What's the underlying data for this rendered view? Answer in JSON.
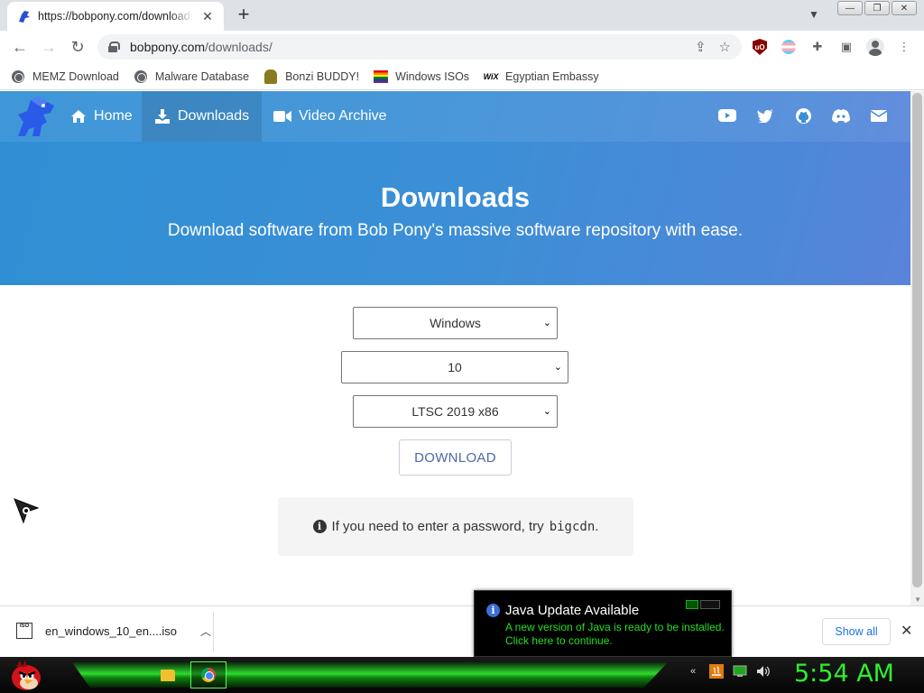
{
  "browser": {
    "tab": {
      "title": "https://bobpony.com/downloads/"
    },
    "url": {
      "host": "bobpony.com",
      "path": "/downloads/"
    },
    "bookmarks": [
      {
        "label": "MEMZ Download",
        "icon": "globe-icon"
      },
      {
        "label": "Malware Database",
        "icon": "globe-icon"
      },
      {
        "label": "Bonzi BUDDY!",
        "icon": "bonzi-icon"
      },
      {
        "label": "Windows ISOs",
        "icon": "rainbow-flag-icon"
      },
      {
        "label": "Egyptian Embassy",
        "icon": "wix-icon",
        "icon_text": "WiX"
      }
    ]
  },
  "site": {
    "nav": [
      {
        "label": "Home",
        "icon": "home-icon",
        "active": false
      },
      {
        "label": "Downloads",
        "icon": "download-icon",
        "active": true
      },
      {
        "label": "Video Archive",
        "icon": "video-icon",
        "active": false
      }
    ],
    "social": [
      "youtube-icon",
      "twitter-icon",
      "github-icon",
      "discord-icon",
      "mail-icon"
    ],
    "hero": {
      "title": "Downloads",
      "subtitle": "Download software from Bob Pony's massive software repository with ease."
    },
    "selects": {
      "os": "Windows",
      "version": "10",
      "edition": "LTSC 2019 x86"
    },
    "download_button": "DOWNLOAD",
    "notice": {
      "text": "If you need to enter a password, try",
      "password": "bigcdn",
      "suffix": "."
    }
  },
  "download_bar": {
    "file_name": "en_windows_10_en....iso",
    "file_icon_text": "ISO",
    "show_all": "Show all"
  },
  "java_popup": {
    "title": "Java Update Available",
    "line1": "A new version of Java is ready to be installed.",
    "line2": "Click here to continue."
  },
  "taskbar": {
    "clock": "5:54 AM",
    "colors": {
      "accent": "#2df02d"
    }
  }
}
